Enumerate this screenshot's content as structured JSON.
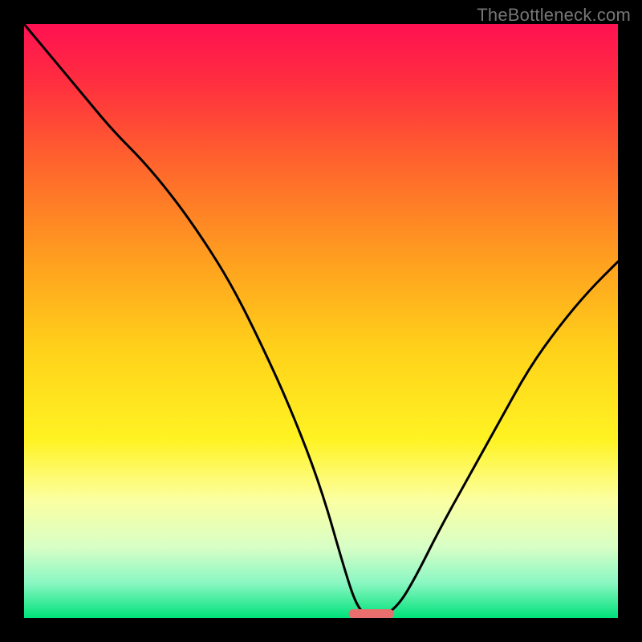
{
  "watermark": "TheBottleneck.com",
  "colors": {
    "frame": "#000000",
    "gradient_stops": [
      {
        "offset": 0.0,
        "color": "#ff1152"
      },
      {
        "offset": 0.1,
        "color": "#ff2f3f"
      },
      {
        "offset": 0.25,
        "color": "#ff6a2b"
      },
      {
        "offset": 0.4,
        "color": "#ffa01f"
      },
      {
        "offset": 0.55,
        "color": "#ffd21a"
      },
      {
        "offset": 0.7,
        "color": "#fff323"
      },
      {
        "offset": 0.8,
        "color": "#fcffa0"
      },
      {
        "offset": 0.88,
        "color": "#d8ffc6"
      },
      {
        "offset": 0.94,
        "color": "#8cf7c3"
      },
      {
        "offset": 1.0,
        "color": "#00e27a"
      }
    ],
    "curve": "#000000",
    "marker_fill": "#e86f6d",
    "marker_stroke": "#e86f6d"
  },
  "chart_data": {
    "type": "line",
    "title": "",
    "xlabel": "",
    "ylabel": "",
    "xlim": [
      0,
      100
    ],
    "ylim": [
      0,
      100
    ],
    "grid": false,
    "legend": false,
    "annotations": [],
    "series": [
      {
        "name": "bottleneck-curve",
        "x": [
          0,
          5,
          10,
          15,
          20,
          25,
          30,
          35,
          40,
          45,
          50,
          54,
          56,
          58,
          60,
          63,
          66,
          70,
          75,
          80,
          85,
          90,
          95,
          100
        ],
        "y": [
          100,
          94,
          88,
          82,
          77,
          71,
          64,
          56,
          46,
          35,
          22,
          8,
          2,
          0,
          0,
          2,
          7,
          15,
          24,
          33,
          42,
          49,
          55,
          60
        ]
      }
    ],
    "marker": {
      "x_center": 58.5,
      "y_center": 0.7,
      "width": 7.5,
      "height": 1.4
    }
  }
}
